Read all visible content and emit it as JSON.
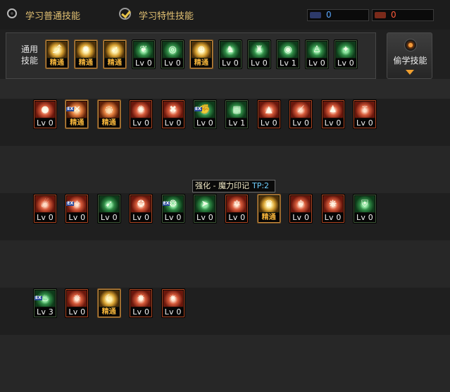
{
  "tabs": {
    "normal_label": "学习普通技能",
    "special_label": "学习特性技能"
  },
  "sp": {
    "first_value": "0",
    "first_color": "#5aa8ff",
    "second_value": "0",
    "second_color": "#ff5a3a"
  },
  "common_panel": {
    "label": "通用\n技能",
    "skills": [
      {
        "icon": "leap-icon",
        "level": "精通"
      },
      {
        "icon": "burst-icon",
        "level": "精通"
      },
      {
        "icon": "dash-icon",
        "level": "精通"
      },
      {
        "icon": "wings-icon",
        "level": "Lv 0"
      },
      {
        "icon": "target-icon",
        "level": "Lv 0"
      },
      {
        "icon": "crosshair-icon",
        "level": "精通"
      },
      {
        "icon": "soldier-icon",
        "level": "Lv 0"
      },
      {
        "icon": "helmet-icon",
        "level": "Lv 0"
      },
      {
        "icon": "eye-icon",
        "level": "Lv 1"
      },
      {
        "icon": "statue-icon",
        "level": "Lv 0"
      },
      {
        "icon": "ward-icon",
        "level": "Lv 0"
      }
    ]
  },
  "steal": {
    "label": "偷学技能"
  },
  "rows": [
    {
      "skills": [
        {
          "icon": "fireball-icon",
          "level": "Lv 0",
          "color": "red",
          "ex": false
        },
        {
          "icon": "split-icon",
          "level": "精通",
          "color": "red",
          "ex": true
        },
        {
          "icon": "whirl-icon",
          "level": "精通",
          "color": "red",
          "ex": false
        },
        {
          "icon": "rune-icon",
          "level": "Lv 0",
          "color": "red",
          "ex": false
        },
        {
          "icon": "cross-icon",
          "level": "Lv 0",
          "color": "red",
          "ex": false
        },
        {
          "icon": "fist-icon",
          "level": "Lv 0",
          "color": "green",
          "ex": true
        },
        {
          "icon": "book-icon",
          "level": "Lv 1",
          "color": "green",
          "ex": false
        },
        {
          "icon": "witch-icon",
          "level": "Lv 0",
          "color": "red",
          "ex": false
        },
        {
          "icon": "slash-icon",
          "level": "Lv 0",
          "color": "red",
          "ex": false
        },
        {
          "icon": "mage-icon",
          "level": "Lv 0",
          "color": "red",
          "ex": false
        },
        {
          "icon": "staff-icon",
          "level": "Lv 0",
          "color": "red",
          "ex": false
        }
      ]
    },
    {
      "skills": [
        {
          "icon": "comet-icon",
          "level": "Lv 0",
          "color": "red",
          "ex": false
        },
        {
          "icon": "spark-icon",
          "level": "Lv 0",
          "color": "red",
          "ex": true
        },
        {
          "icon": "runner-icon",
          "level": "Lv 0",
          "color": "green",
          "ex": false
        },
        {
          "icon": "beast-icon",
          "level": "Lv 0",
          "color": "red",
          "ex": false
        },
        {
          "icon": "orbs-icon",
          "level": "Lv 0",
          "color": "green",
          "ex": true
        },
        {
          "icon": "charge-icon",
          "level": "Lv 0",
          "color": "green",
          "ex": false
        },
        {
          "icon": "pentagram-icon",
          "level": "Lv 0",
          "color": "red",
          "ex": false
        },
        {
          "icon": "crown-icon",
          "level": "精通",
          "color": "green",
          "ex": false
        },
        {
          "icon": "dragon-icon",
          "level": "Lv 0",
          "color": "red",
          "ex": false
        },
        {
          "icon": "ball-icon",
          "level": "Lv 0",
          "color": "red",
          "ex": false
        },
        {
          "icon": "shield-icon",
          "level": "Lv 0",
          "color": "green",
          "ex": false
        }
      ]
    },
    {
      "skills": [
        {
          "icon": "flame-icon",
          "level": "Lv 3",
          "color": "green",
          "ex": true
        },
        {
          "icon": "vortex-icon",
          "level": "Lv 0",
          "color": "red",
          "ex": false
        },
        {
          "icon": "moon-icon",
          "level": "精通",
          "color": "green",
          "ex": false
        },
        {
          "icon": "blast-icon",
          "level": "Lv 0",
          "color": "red",
          "ex": false
        },
        {
          "icon": "star-icon",
          "level": "Lv 0",
          "color": "red",
          "ex": false
        }
      ]
    }
  ],
  "tooltip": {
    "name": "强化 - 魔力印记",
    "tp": "TP:2"
  },
  "glyphs": {
    "leap-icon": "⤴",
    "burst-icon": "✹",
    "dash-icon": "➶",
    "wings-icon": "❦",
    "target-icon": "◎",
    "crosshair-icon": "⊕",
    "soldier-icon": "♞",
    "helmet-icon": "♜",
    "eye-icon": "◉",
    "statue-icon": "♙",
    "ward-icon": "✦",
    "fireball-icon": "●",
    "split-icon": "✕",
    "whirl-icon": "◌",
    "rune-icon": "✺",
    "cross-icon": "✖",
    "fist-icon": "✊",
    "book-icon": "▤",
    "witch-icon": "▲",
    "slash-icon": "⟋",
    "mage-icon": "♟",
    "staff-icon": "⚚",
    "comet-icon": "☄",
    "spark-icon": "✧",
    "runner-icon": "➹",
    "beast-icon": "✪",
    "orbs-icon": "❂",
    "charge-icon": "➤",
    "pentagram-icon": "✡",
    "crown-icon": "♛",
    "dragon-icon": "☬",
    "ball-icon": "❋",
    "shield-icon": "⛨",
    "flame-icon": "♨",
    "vortex-icon": "✵",
    "moon-icon": "☾",
    "blast-icon": "✸",
    "star-icon": "✷"
  }
}
